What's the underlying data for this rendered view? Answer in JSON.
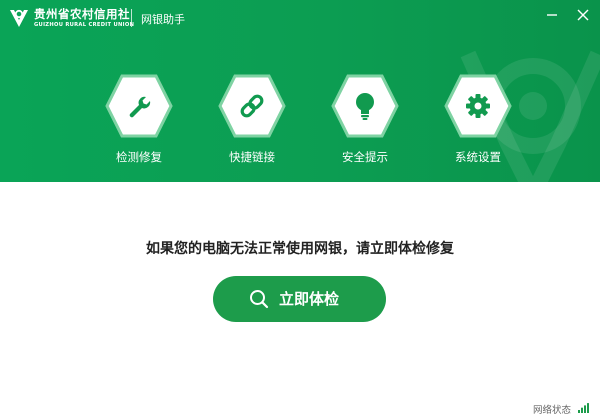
{
  "titlebar": {
    "brand_cn": "贵州省农村信用社",
    "brand_en": "GUIZHOU RURAL CREDIT UNION",
    "app_title": "网银助手"
  },
  "nav": {
    "items": [
      {
        "label": "检测修复",
        "icon": "wrench-icon"
      },
      {
        "label": "快捷链接",
        "icon": "link-icon"
      },
      {
        "label": "安全提示",
        "icon": "lightbulb-icon"
      },
      {
        "label": "系统设置",
        "icon": "gear-icon"
      }
    ]
  },
  "main": {
    "message": "如果您的电脑无法正常使用网银，请立即体检修复",
    "check_button": "立即体检"
  },
  "status": {
    "label": "网络状态",
    "signal_level": 4
  },
  "colors": {
    "brand_green": "#0aa457",
    "button_green": "#1d9c4b",
    "icon_green": "#119a4f"
  }
}
